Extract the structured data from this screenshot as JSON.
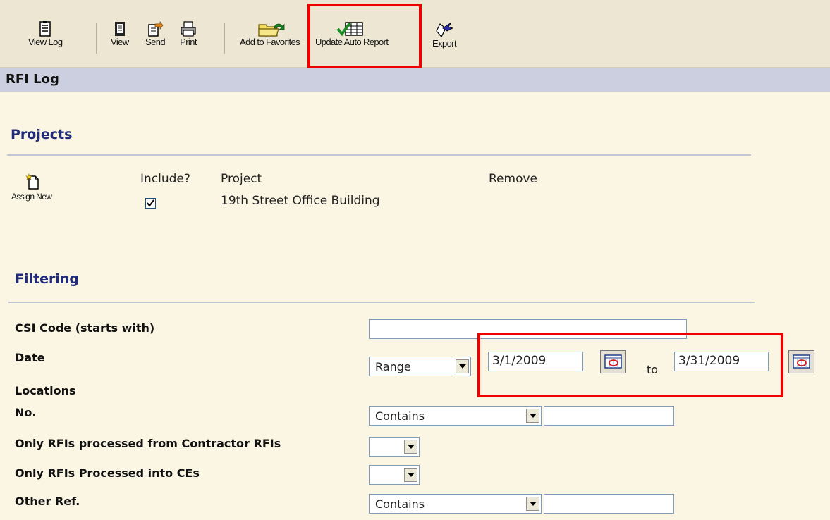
{
  "toolbar": {
    "view_log": "View Log",
    "view": "View",
    "send": "Send",
    "print": "Print",
    "add_to_favorites": "Add to Favorites",
    "update_auto_report": "Update Auto Report",
    "export": "Export"
  },
  "page_title": "RFI Log",
  "projects": {
    "heading": "Projects",
    "assign_new": "Assign New",
    "col_include": "Include?",
    "col_project": "Project",
    "col_remove": "Remove",
    "rows": [
      {
        "included": true,
        "name": "19th Street Office Building"
      }
    ]
  },
  "filtering": {
    "heading": "Filtering",
    "csi_label": "CSI Code (starts with)",
    "csi_value": "",
    "date_label": "Date",
    "date_mode": "Range",
    "date_from": "3/1/2009",
    "date_to_word": "to",
    "date_to": "3/31/2009",
    "locations_label": "Locations",
    "no_label": "No.",
    "no_mode": "Contains",
    "no_value": "",
    "contractor_label": "Only RFIs processed from Contractor RFIs",
    "contractor_value": "",
    "ces_label": "Only RFIs Processed into CEs",
    "ces_value": "",
    "other_ref_label": "Other Ref.",
    "other_ref_mode": "Contains",
    "other_ref_value": ""
  },
  "icons": [
    "view-log-icon",
    "view-icon",
    "send-icon",
    "print-icon",
    "add-to-favorites-icon",
    "update-auto-report-icon",
    "export-icon",
    "assign-new-icon",
    "calendar-icon"
  ],
  "colors": {
    "highlight": "#ee0000",
    "section_heading": "#202a7a",
    "title_bar": "#cbcfe0",
    "background": "#fbf6e3"
  }
}
